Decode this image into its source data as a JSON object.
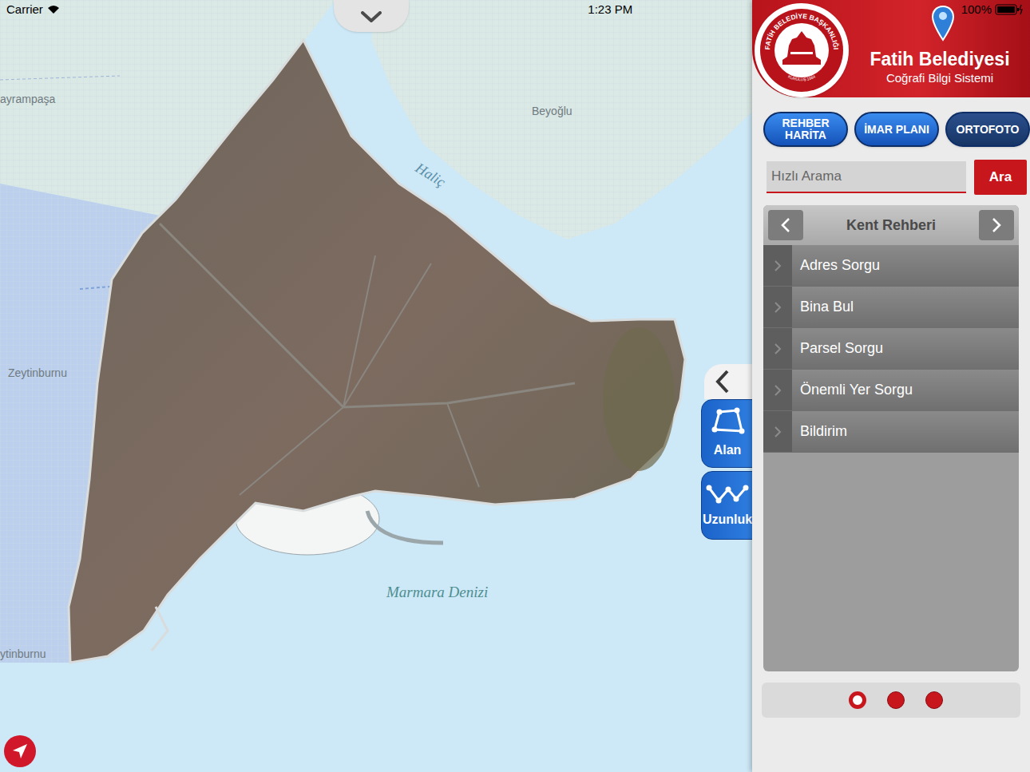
{
  "status_bar": {
    "carrier": "Carrier",
    "time": "1:23 PM",
    "battery": "100%"
  },
  "header": {
    "logo_text": "FATİH BELEDİYE BAŞKANLIĞI",
    "logo_year": "KURULUŞ 1984",
    "title": "Fatih Belediyesi",
    "subtitle": "Coğrafi Bilgi Sistemi"
  },
  "layer_buttons": [
    {
      "label": "REHBER HARİTA",
      "selected": false
    },
    {
      "label": "İMAR PLANI",
      "selected": false
    },
    {
      "label": "ORTOFOTO",
      "selected": true
    }
  ],
  "search": {
    "placeholder": "Hızlı Arama",
    "button": "Ara"
  },
  "menu": {
    "title": "Kent Rehberi",
    "items": [
      "Adres Sorgu",
      "Bina Bul",
      "Parsel Sorgu",
      "Önemli Yer Sorgu",
      "Bildirim"
    ]
  },
  "pages": [
    {
      "selected": true
    },
    {
      "selected": false
    },
    {
      "selected": false
    }
  ],
  "tools": [
    {
      "label": "Alan"
    },
    {
      "label": "Uzunluk"
    }
  ],
  "map": {
    "labels": [
      "ayrampaşa",
      "Beyoğlu",
      "Haliç",
      "Zeytinburnu",
      "ytinburnu",
      "Marmara Denizi"
    ]
  }
}
